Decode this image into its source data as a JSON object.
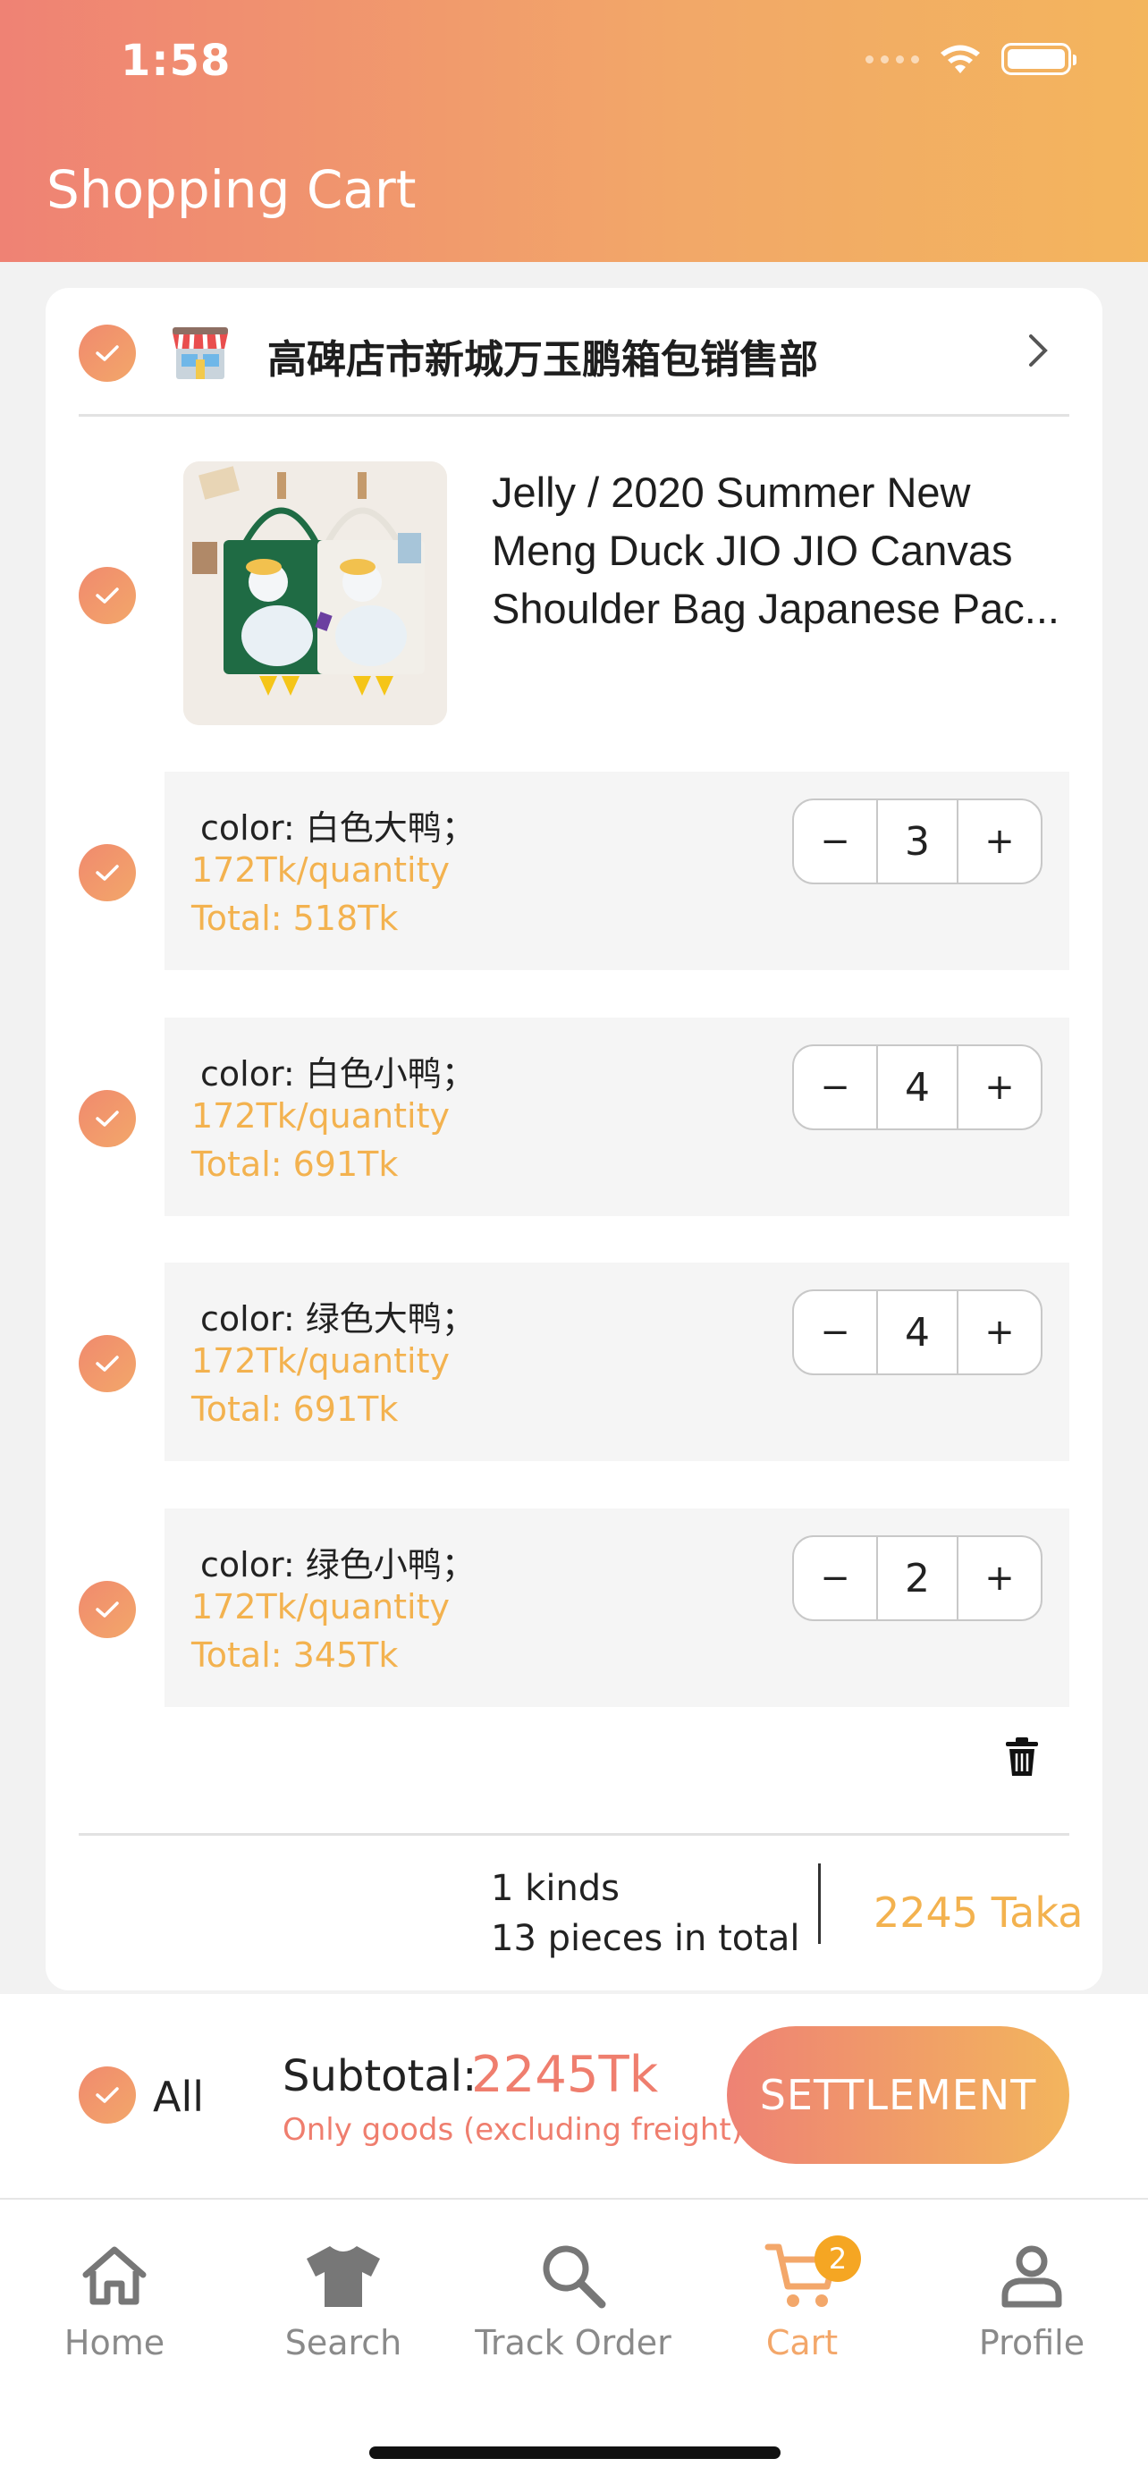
{
  "status_bar": {
    "time": "1:58"
  },
  "header": {
    "title": "Shopping Cart"
  },
  "store": {
    "name": "高碑店市新城万玉鹏箱包销售部",
    "icon": "store-icon"
  },
  "product": {
    "title": "Jelly / 2020 Summer New Meng Duck JIO JIO Canvas Shoulder Bag Japanese Pac..."
  },
  "variants": [
    {
      "color": "color: 白色大鸭；",
      "price": "172Tk/quantity",
      "total": "Total: 518Tk",
      "qty": "3"
    },
    {
      "color": "color: 白色小鸭；",
      "price": "172Tk/quantity",
      "total": "Total: 691Tk",
      "qty": "4"
    },
    {
      "color": "color: 绿色大鸭；",
      "price": "172Tk/quantity",
      "total": "Total: 691Tk",
      "qty": "4"
    },
    {
      "color": "color: 绿色小鸭；",
      "price": "172Tk/quantity",
      "total": "Total: 345Tk",
      "qty": "2"
    }
  ],
  "stepper": {
    "minus": "−",
    "plus": "+"
  },
  "summary": {
    "kinds": "1 kinds",
    "pieces": "13 pieces in total",
    "total": "2245 Taka"
  },
  "settle": {
    "all_label": "All",
    "subtotal_label": "Subtotal:",
    "subtotal_value": "2245Tk",
    "note": "Only goods (excluding freight)",
    "button": "SETTLEMENT"
  },
  "tabs": [
    {
      "label": "Home",
      "icon": "home-icon"
    },
    {
      "label": "Search",
      "icon": "shirt-icon"
    },
    {
      "label": "Track Order",
      "icon": "search-icon"
    },
    {
      "label": "Cart",
      "icon": "cart-icon",
      "badge": "2",
      "active": true
    },
    {
      "label": "Profile",
      "icon": "person-icon"
    }
  ],
  "colors": {
    "accent": "#f3b24f",
    "brand": "#ef8274",
    "active_tab": "#f3a76a"
  }
}
